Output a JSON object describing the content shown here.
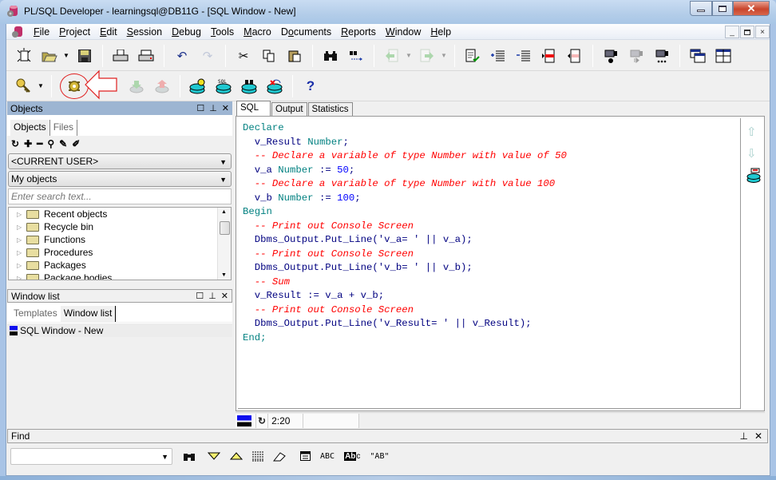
{
  "window": {
    "title": "PL/SQL Developer - learningsql@DB11G - [SQL Window - New]",
    "controls": {
      "minimize": "—",
      "maximize": "▭",
      "close": "✕"
    },
    "mdi_controls": {
      "minimize": "_",
      "restore": "🗗",
      "close": "×"
    }
  },
  "menu": [
    {
      "label": "File",
      "underline": "F",
      "rest": "ile"
    },
    {
      "label": "Project",
      "underline": "P",
      "rest": "roject"
    },
    {
      "label": "Edit",
      "underline": "E",
      "rest": "dit"
    },
    {
      "label": "Session",
      "underline": "S",
      "rest": "ession"
    },
    {
      "label": "Debug",
      "underline": "D",
      "rest": "ebug"
    },
    {
      "label": "Tools",
      "underline": "T",
      "rest": "ools"
    },
    {
      "label": "Macro",
      "underline": "M",
      "rest": "acro"
    },
    {
      "label": "Documents",
      "pre": "D",
      "underline": "o",
      "rest": "cuments"
    },
    {
      "label": "Reports",
      "underline": "R",
      "rest": "eports"
    },
    {
      "label": "Window",
      "underline": "W",
      "rest": "indow"
    },
    {
      "label": "Help",
      "underline": "H",
      "rest": "elp"
    }
  ],
  "toolbar1": {
    "icons": [
      "new-icon",
      "open-icon",
      "save-icon",
      "print-icon",
      "print-preview-icon",
      "undo-icon",
      "redo-icon",
      "cut-icon",
      "copy-icon",
      "paste-icon",
      "find-icon",
      "find-next-icon",
      "back-icon",
      "forward-icon",
      "check-syntax-icon",
      "indent-icon",
      "unindent-icon",
      "comment-icon",
      "uncomment-icon",
      "record-macro-icon",
      "play-macro-icon",
      "macro-library-icon",
      "window-list-icon",
      "tile-windows-icon"
    ]
  },
  "toolbar2": {
    "icons": [
      "logon-icon",
      "execute-icon",
      "fetch-next-icon",
      "fetch-last-icon",
      "commit-icon",
      "sql-session-icon",
      "find-db-object-icon",
      "rollback-icon",
      "help-icon"
    ],
    "help_glyph": "?",
    "annotation": "execute button highlighted with red circle and arrow"
  },
  "objects_panel": {
    "title": "Objects",
    "tabs": [
      "Objects",
      "Files"
    ],
    "active_tab": "Objects",
    "user_combo": "<CURRENT USER>",
    "filter_combo": "My objects",
    "search_placeholder": "Enter search text...",
    "tree": [
      "Recent objects",
      "Recycle bin",
      "Functions",
      "Procedures",
      "Packages",
      "Package bodies"
    ]
  },
  "window_list_panel": {
    "title": "Window list",
    "tabs": [
      "Templates",
      "Window list"
    ],
    "active_tab": "Window list",
    "items": [
      "SQL Window - New"
    ]
  },
  "editor": {
    "tabs": [
      "SQL",
      "Output",
      "Statistics"
    ],
    "active_tab": "SQL",
    "lines": [
      [
        {
          "t": "Declare",
          "c": "kw"
        }
      ],
      [
        {
          "t": "  v_Result ",
          "c": "id"
        },
        {
          "t": "Number",
          "c": "kw"
        },
        {
          "t": ";",
          "c": "id"
        }
      ],
      [
        {
          "t": "  -- Declare a variable of type Number with value of 50",
          "c": "cm"
        }
      ],
      [
        {
          "t": "  v_a ",
          "c": "id"
        },
        {
          "t": "Number",
          "c": "kw"
        },
        {
          "t": " := ",
          "c": "id"
        },
        {
          "t": "50",
          "c": "num"
        },
        {
          "t": ";",
          "c": "id"
        }
      ],
      [
        {
          "t": "  -- Declare a variable of type Number with value 100",
          "c": "cm"
        }
      ],
      [
        {
          "t": "  v_b ",
          "c": "id"
        },
        {
          "t": "Number",
          "c": "kw"
        },
        {
          "t": " := ",
          "c": "id"
        },
        {
          "t": "100",
          "c": "num"
        },
        {
          "t": ";",
          "c": "id"
        }
      ],
      [
        {
          "t": "Begin",
          "c": "kw"
        }
      ],
      [
        {
          "t": "  -- Print out Console Screen",
          "c": "cm"
        }
      ],
      [
        {
          "t": "  Dbms_Output.Put_Line('v_a= ' || v_a);",
          "c": "id"
        }
      ],
      [
        {
          "t": "  -- Print out Console Screen",
          "c": "cm"
        }
      ],
      [
        {
          "t": "  Dbms_Output.Put_Line('v_b= ' || v_b);",
          "c": "id"
        }
      ],
      [
        {
          "t": "  -- Sum",
          "c": "cm"
        }
      ],
      [
        {
          "t": "  v_Result := v_a + v_b;",
          "c": "id"
        }
      ],
      [
        {
          "t": "  -- Print out Console Screen",
          "c": "cm"
        }
      ],
      [
        {
          "t": "  Dbms_Output.Put_Line('v_Result= ' || v_Result);",
          "c": "id"
        }
      ],
      [
        {
          "t": "End;",
          "c": "kw"
        }
      ]
    ],
    "side_icons": {
      "up": "⇧",
      "down": "⇩"
    }
  },
  "status": {
    "cursor": "2:20"
  },
  "find": {
    "title": "Find",
    "input_value": "",
    "buttons": {
      "abc": "ABC",
      "abc_inverse": "Ab",
      "quoted": "\"AB\""
    }
  },
  "colors": {
    "keyword": "#008080",
    "comment": "#ff0000",
    "number": "#0000ff",
    "identifier": "#000080",
    "panel_header": "#9db5d2",
    "annotation_red": "#e02020"
  }
}
